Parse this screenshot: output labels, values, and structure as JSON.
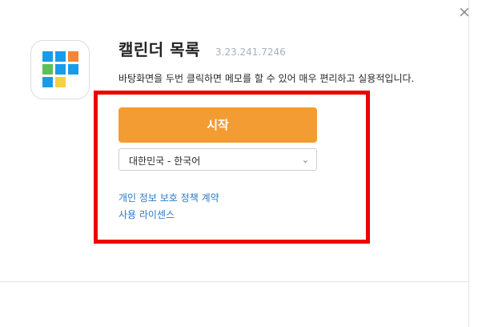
{
  "dialog": {
    "close_label": "×",
    "app": {
      "title": "캘린더 목록",
      "version": "3.23.241.7246",
      "description": "바탕화면을 두번 클릭하면 메모를 할 수 있어 매우 편리하고 실용적입니다."
    },
    "start_button_label": "시작",
    "language": {
      "selected": "대한민국 - 한국어",
      "chevron_icon": "chevron-down-icon"
    },
    "links": {
      "privacy_policy": "개인 정보 보호 정책 계약",
      "license": "사용 라이센스"
    },
    "colors": {
      "accent": "#f39c33",
      "link": "#2a78c6",
      "highlight": "#ee0000",
      "version_text": "#a7b1be",
      "tile_blue": "#1a9be8",
      "tile_orange": "#f0873a",
      "tile_green": "#5cc15a",
      "tile_yellow": "#f5cf45"
    }
  }
}
